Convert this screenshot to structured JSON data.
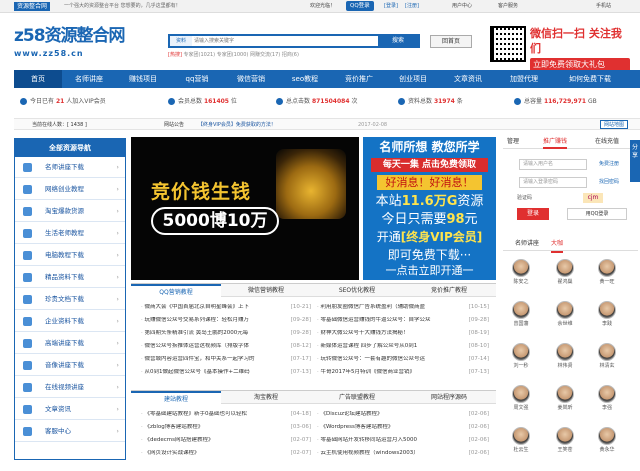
{
  "topbar": {
    "brand": "资源整合网",
    "slogan": "一个强大的资源整合平台 您想要的，几乎这里都有！",
    "welcome": "欢迎光临！",
    "qq_login": "QQ登录",
    "login": "[登录]",
    "register": "[注册]",
    "user_center": "用户中心",
    "customer_service": "客户服务",
    "mobile": "手机站"
  },
  "logo": {
    "mark": "z58",
    "text": "资源整合网",
    "url": "www.zz58.cn"
  },
  "search": {
    "category": "资料",
    "placeholder": "请输入搜索关键字",
    "button": "搜索",
    "back_home": "回首页",
    "hot_label": "[热搜]",
    "hot_items": [
      "专家团(1021)",
      "专家团(1000)",
      "网赚交流(17)",
      "招商(6)"
    ]
  },
  "wechat": {
    "line1": "微信扫一扫 关注我们",
    "line2": "立即免费领取大礼包"
  },
  "nav": [
    "首页",
    "名师讲座",
    "赚钱项目",
    "qq营销",
    "微信营销",
    "seo教程",
    "竞价推广",
    "创业项目",
    "文章资讯",
    "加盟代理",
    "如何免费下载"
  ],
  "stats": {
    "today_label": "今日已有",
    "today_value": "21",
    "today_suffix": "人加入VIP会员",
    "members_label": "会员总数",
    "members_value": "161405",
    "members_unit": "位",
    "clicks_label": "总点击数",
    "clicks_value": "871504084",
    "clicks_unit": "次",
    "resources_label": "资料总数",
    "resources_value": "31974",
    "resources_unit": "条",
    "capacity_label": "总容量",
    "capacity_value": "116,729,971",
    "capacity_unit": "GB"
  },
  "notice": {
    "online_label": "当前在线人数：[ 1438 ]",
    "site_notice_label": "网站公告",
    "site_notice_text": "【终身VIP会员】免费获取的方法！",
    "site_notice_date": "2017-02-08",
    "map_button": "网站地图"
  },
  "sidebar": {
    "title": "全部资源导航",
    "items": [
      "名师讲座下载",
      "网络创业教程",
      "淘宝爆款货源",
      "生活老师教程",
      "电脑教程下载",
      "精品资料下载",
      "珍贵文档下载",
      "企业资料下载",
      "高端讲座下载",
      "音像讲座下载",
      "在线视频讲座",
      "文章资讯",
      "客服中心"
    ]
  },
  "banner": {
    "title_prefix": "竞价",
    "title_highlight": "钱生钱",
    "subtitle": "5000博10万"
  },
  "promo": {
    "line1": "名师所想 教您所学",
    "line2": "每天一集 点击免费领取",
    "line3": "好消息！好消息！",
    "line4_prefix": "本站",
    "line4_value": "11.6万G",
    "line4_suffix": "资源",
    "line5_prefix": "今日只需要",
    "line5_value": "98",
    "line5_suffix": "元",
    "line6_prefix": "开通",
    "line6_value": "[终身VIP会员]",
    "line7": "即可免费下载···",
    "line8": "一点击立即开通一"
  },
  "login": {
    "tab_manage": "管理",
    "tab_vip": "推广赚钱",
    "tab_service": "在线充值",
    "username_placeholder": "请输入用户名",
    "password_placeholder": "请输入登录密码",
    "register_link": "免费注册",
    "forgot_link": "找回密码",
    "captcha_label": "验证码",
    "captcha_value": "cjm",
    "login_button": "登录",
    "qq_login_button": "用QQ登录"
  },
  "lecture": {
    "tab1": "名师讲座",
    "tab2": "大咖",
    "people": [
      "陈安之",
      "翟鸿燊",
      "黄一旺",
      "曾国藩",
      "余世维",
      "李践",
      "刘一秒",
      "林伟贤",
      "林清玄",
      "周文强",
      "姜岚昕",
      "李强",
      "杜云生",
      "王笑苍",
      "黄永华"
    ]
  },
  "share": "分享",
  "panel1": {
    "tabs": [
      "QQ营销教程",
      "微信营销教程",
      "SEO优化教程",
      "竞价推广教程"
    ],
    "left": [
      {
        "title": "微商大会《中国首届北京自明星峰会》上下",
        "date": "[10-21]"
      },
      {
        "title": "玩赚微信公众号交易系列课程：轻松月赚万",
        "date": "[09-28]"
      },
      {
        "title": "第四期头条精准引流 黄岛王鹏的2000元每",
        "date": "[09-28]"
      },
      {
        "title": "微信公众号拆推体运营这视频库（排版字体",
        "date": "[08-12]"
      },
      {
        "title": "微营城内容运营四件宝，和中关系一起学习的",
        "date": "[07-17]"
      },
      {
        "title": "从0到1做起微信公众号《基本操作+二维码",
        "date": "[07-13]"
      }
    ],
    "right": [
      {
        "title": "利用朋友圈微信广告系统盈利（辅助微商盈",
        "date": "[10-15]"
      },
      {
        "title": "零基础微信运营赚钱的牛逼公众号：自学公众",
        "date": "[09-28]"
      },
      {
        "title": "财神大微公众号十大赚钱方法揭秘！",
        "date": "[08-19]"
      },
      {
        "title": "新媒体运营课程 四步了解公众号从0到1",
        "date": "[08-10]"
      },
      {
        "title": "玩转微信公众号：一套有趣的微信公众号运",
        "date": "[07-14]"
      },
      {
        "title": "牛哥2017年5月特训《微信商业营销》",
        "date": "[07-13]"
      }
    ]
  },
  "panel2": {
    "tabs": [
      "建站教程",
      "淘宝教程",
      "广告联盟教程",
      "网站程序源码"
    ],
    "left": [
      {
        "title": "《零基础建站教程》新手0基础也可以轻松",
        "date": "[04-18]"
      },
      {
        "title": "《zblog博客建站教程》",
        "date": "[03-06]"
      },
      {
        "title": "《dedecms网站搭建教程》",
        "date": "[02-07]"
      },
      {
        "title": "《网页设计实战课程》",
        "date": "[02-07]"
      }
    ],
    "right": [
      {
        "title": "《Discuz论坛建站教程》",
        "date": "[02-06]"
      },
      {
        "title": "《Wordpress博客建站教程》",
        "date": "[02-06]"
      },
      {
        "title": "零基础网站开发转移同站运营月入5000",
        "date": "[02-06]"
      },
      {
        "title": "云主机使用视频教程（windows2003）",
        "date": "[02-06]"
      }
    ]
  }
}
